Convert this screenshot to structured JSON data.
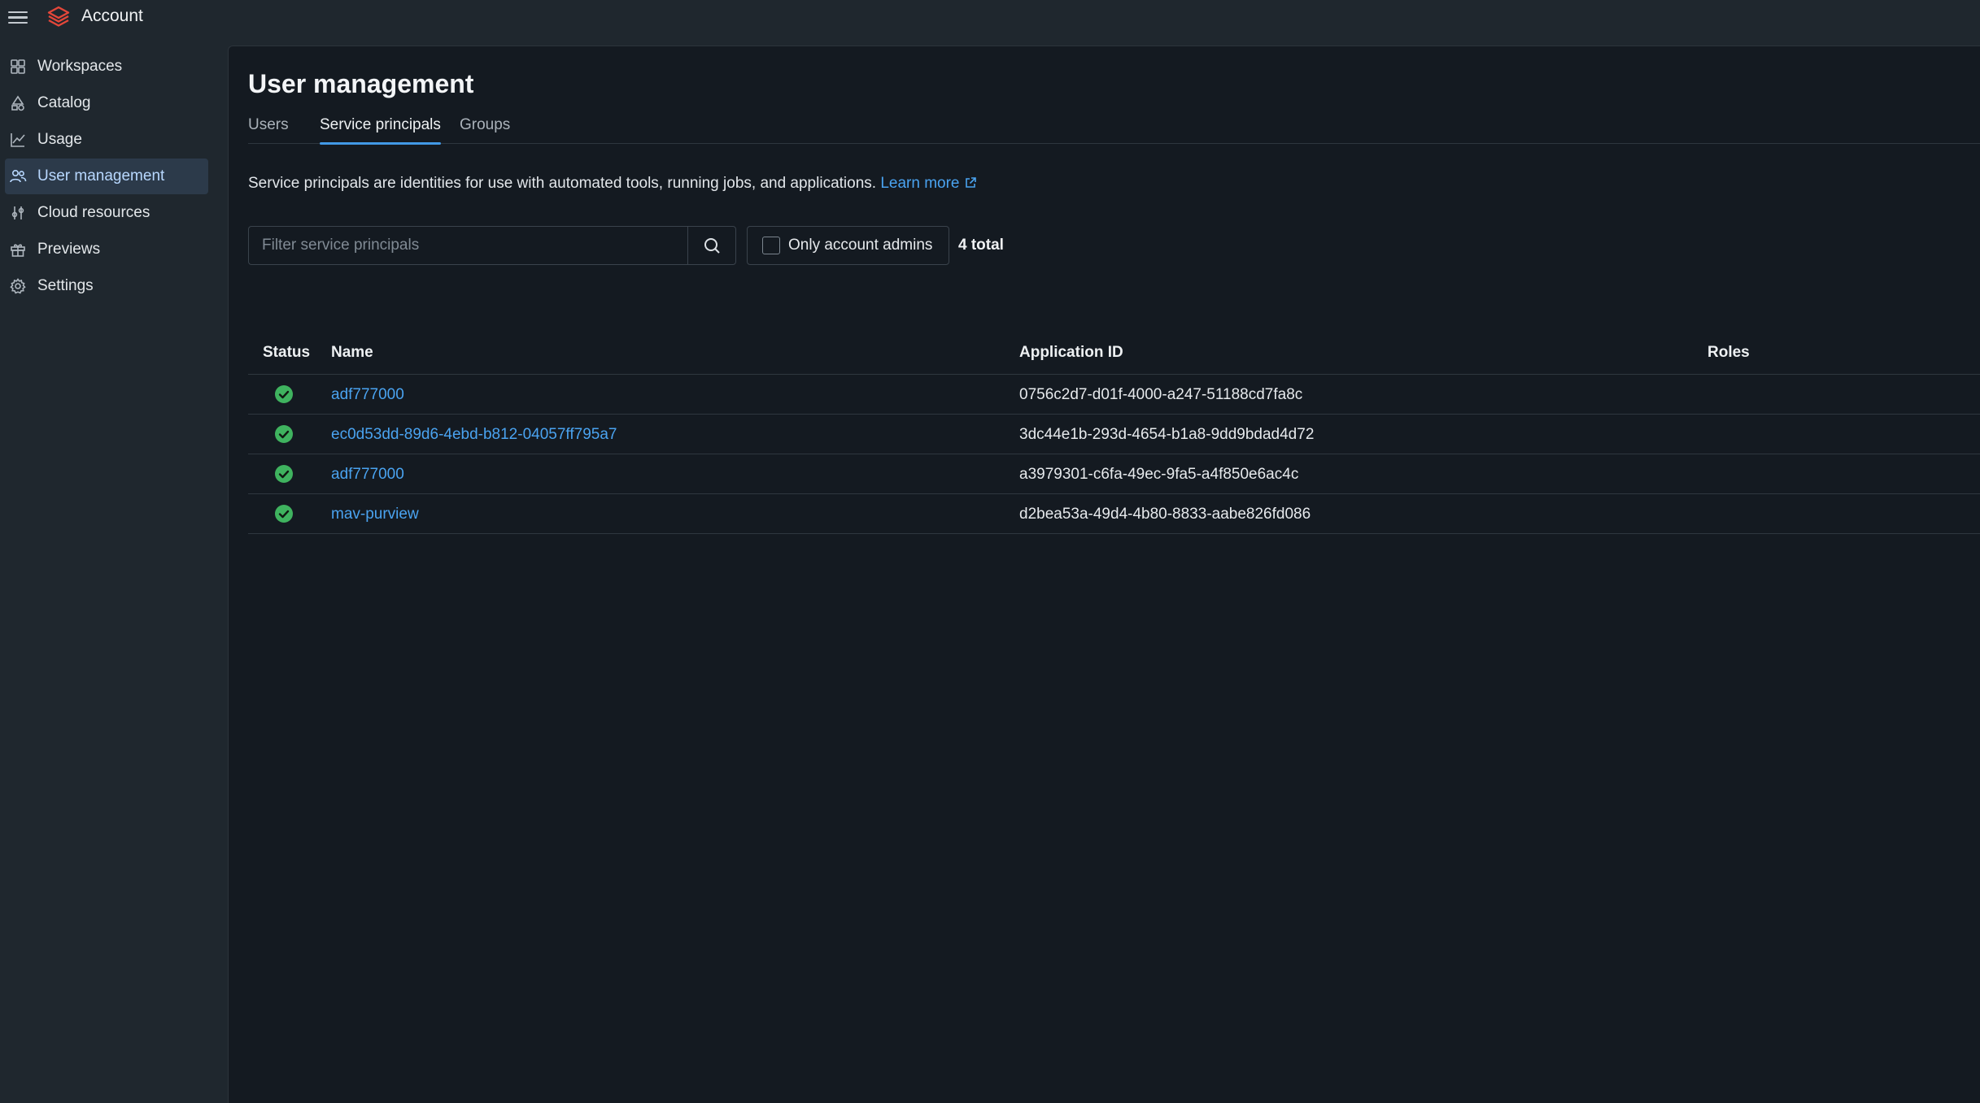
{
  "header": {
    "title": "Account"
  },
  "sidebar": {
    "items": [
      {
        "label": "Workspaces",
        "icon": "workspaces-icon"
      },
      {
        "label": "Catalog",
        "icon": "catalog-icon"
      },
      {
        "label": "Usage",
        "icon": "usage-icon"
      },
      {
        "label": "User management",
        "icon": "users-icon",
        "active": true
      },
      {
        "label": "Cloud resources",
        "icon": "cloud-resources-icon"
      },
      {
        "label": "Previews",
        "icon": "gift-icon"
      },
      {
        "label": "Settings",
        "icon": "gear-icon"
      }
    ]
  },
  "main": {
    "title": "User management",
    "tabs": [
      {
        "label": "Users"
      },
      {
        "label": "Service principals",
        "active": true
      },
      {
        "label": "Groups"
      }
    ],
    "description": "Service principals are identities for use with automated tools, running jobs, and applications.",
    "learn_more": "Learn more",
    "filter": {
      "placeholder": "Filter service principals",
      "value": ""
    },
    "only_admins_label": "Only account admins",
    "total": "4 total",
    "table": {
      "columns": [
        "Status",
        "Name",
        "Application ID",
        "Roles"
      ],
      "rows": [
        {
          "status": "active",
          "name": "adf777000",
          "app_id": "0756c2d7-d01f-4000-a247-51188cd7fa8c",
          "roles": ""
        },
        {
          "status": "active",
          "name": "ec0d53dd-89d6-4ebd-b812-04057ff795a7",
          "app_id": "3dc44e1b-293d-4654-b1a8-9dd9bdad4d72",
          "roles": ""
        },
        {
          "status": "active",
          "name": "adf777000",
          "app_id": "a3979301-c6fa-49ec-9fa5-a4f850e6ac4c",
          "roles": ""
        },
        {
          "status": "active",
          "name": "mav-purview",
          "app_id": "d2bea53a-49d4-4b80-8833-aabe826fd086",
          "roles": ""
        }
      ]
    }
  },
  "colors": {
    "accent": "#4299e6",
    "link": "#4aa3f0",
    "status_ok": "#3fb35f",
    "logo": "#e4473a"
  }
}
